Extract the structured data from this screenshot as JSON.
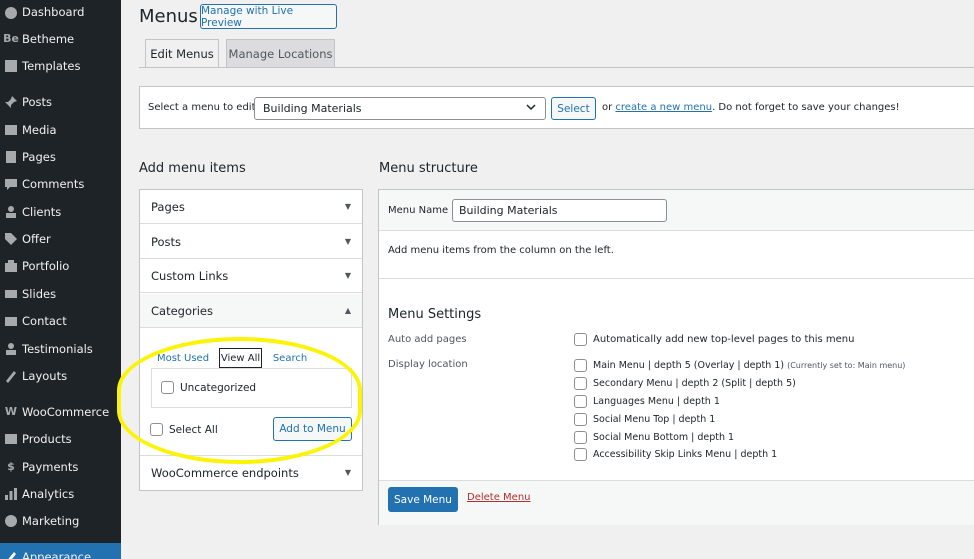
{
  "sidebar": {
    "items": [
      {
        "label": "Dashboard",
        "icon": "dashboard-icon"
      },
      {
        "label": "Betheme",
        "icon": "betheme-icon",
        "glyph": "Be"
      },
      {
        "label": "Templates",
        "icon": "templates-icon"
      },
      {
        "label": "Posts",
        "icon": "pin-icon"
      },
      {
        "label": "Media",
        "icon": "media-icon"
      },
      {
        "label": "Pages",
        "icon": "pages-icon"
      },
      {
        "label": "Comments",
        "icon": "comments-icon"
      },
      {
        "label": "Clients",
        "icon": "clients-icon"
      },
      {
        "label": "Offer",
        "icon": "tag-icon"
      },
      {
        "label": "Portfolio",
        "icon": "portfolio-icon"
      },
      {
        "label": "Slides",
        "icon": "slides-icon"
      },
      {
        "label": "Contact",
        "icon": "envelope-icon"
      },
      {
        "label": "Testimonials",
        "icon": "testimonials-icon"
      },
      {
        "label": "Layouts",
        "icon": "layouts-icon"
      },
      {
        "label": "WooCommerce",
        "icon": "woocommerce-icon",
        "glyph": "W"
      },
      {
        "label": "Products",
        "icon": "products-icon"
      },
      {
        "label": "Payments",
        "icon": "payments-icon",
        "glyph": "$"
      },
      {
        "label": "Analytics",
        "icon": "analytics-icon"
      },
      {
        "label": "Marketing",
        "icon": "marketing-icon"
      },
      {
        "label": "Appearance",
        "icon": "appearance-icon"
      }
    ]
  },
  "header": {
    "title": "Menus",
    "live_preview_label": "Manage with Live Preview"
  },
  "tabs": [
    {
      "label": "Edit Menus",
      "active": true
    },
    {
      "label": "Manage Locations",
      "active": false
    }
  ],
  "select_bar": {
    "label": "Select a menu to edit:",
    "selected_menu": "Building Materials",
    "select_button": "Select",
    "or_text": "or",
    "create_link": "create a new menu",
    "note": ". Do not forget to save your changes!"
  },
  "add_items": {
    "heading": "Add menu items",
    "sections": [
      {
        "label": "Pages",
        "arrow": "▼"
      },
      {
        "label": "Posts",
        "arrow": "▼"
      },
      {
        "label": "Custom Links",
        "arrow": "▼"
      },
      {
        "label": "Categories",
        "arrow": "▲"
      },
      {
        "label": "WooCommerce endpoints",
        "arrow": "▼"
      }
    ],
    "category_tabs": [
      "Most Used",
      "View All",
      "Search"
    ],
    "active_category_tab": "View All",
    "category_items": [
      "Uncategorized"
    ],
    "select_all_label": "Select All",
    "add_button": "Add to Menu"
  },
  "structure": {
    "heading": "Menu structure",
    "name_label": "Menu Name",
    "name_value": "Building Materials",
    "empty_hint": "Add menu items from the column on the left.",
    "settings_heading": "Menu Settings",
    "auto_add_label": "Auto add pages",
    "auto_add_option": "Automatically add new top-level pages to this menu",
    "display_location_label": "Display location",
    "locations": [
      {
        "label": "Main Menu | depth 5 (Overlay | depth 1)",
        "note": "(Currently set to: Main menu)"
      },
      {
        "label": "Secondary Menu | depth 2 (Split | depth 5)",
        "note": ""
      },
      {
        "label": "Languages Menu | depth 1",
        "note": ""
      },
      {
        "label": "Social Menu Top | depth 1",
        "note": ""
      },
      {
        "label": "Social Menu Bottom | depth 1",
        "note": ""
      },
      {
        "label": "Accessibility Skip Links Menu | depth 1",
        "note": ""
      }
    ],
    "save_button": "Save Menu",
    "delete_link": "Delete Menu"
  },
  "colors": {
    "sidebar_bg": "#1d2327",
    "accent": "#2271b1",
    "highlight": "#fbf406",
    "delete": "#b32d2e"
  }
}
